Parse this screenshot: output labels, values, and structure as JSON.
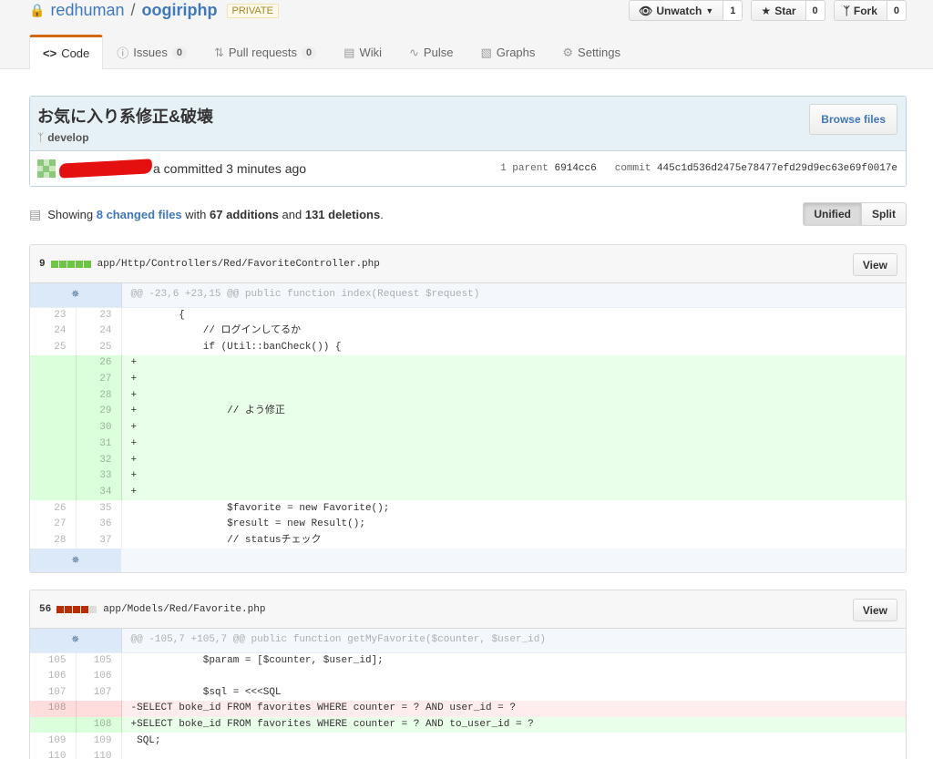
{
  "repo": {
    "owner": "redhuman",
    "name": "oogiriphp",
    "visibility": "PRIVATE"
  },
  "actions": [
    {
      "label": "Unwatch",
      "count": "1"
    },
    {
      "label": "Star",
      "count": "0"
    },
    {
      "label": "Fork",
      "count": "0"
    }
  ],
  "nav": [
    {
      "label": "Code",
      "icon": "code-icon",
      "counter": ""
    },
    {
      "label": "Issues",
      "icon": "issue-icon",
      "counter": "0"
    },
    {
      "label": "Pull requests",
      "icon": "pull-request-icon",
      "counter": "0"
    },
    {
      "label": "Wiki",
      "icon": "book-icon",
      "counter": ""
    },
    {
      "label": "Pulse",
      "icon": "pulse-icon",
      "counter": ""
    },
    {
      "label": "Graphs",
      "icon": "graph-icon",
      "counter": ""
    },
    {
      "label": "Settings",
      "icon": "gear-icon",
      "counter": ""
    }
  ],
  "commit": {
    "title": "お気に入り系修正&破壊",
    "branch": "develop",
    "browse_label": "Browse files",
    "author_tail": "a committed 3 minutes ago",
    "parent_label": "1 parent",
    "parent_sha": "6914cc6",
    "commit_label": "commit",
    "commit_sha": "445c1d536d2475e78477efd29d9ec63e69f0017e"
  },
  "toc": {
    "showing": "Showing",
    "changed": "8 changed files",
    "with": "with",
    "additions": "67 additions",
    "and": "and",
    "deletions": "131 deletions",
    "unified": "Unified",
    "split": "Split"
  },
  "files": [
    {
      "count": "9",
      "path": "app/Http/Controllers/Red/FavoriteController.php",
      "view_label": "View",
      "hunk": "@@ -23,6 +23,15 @@ public function index(Request $request)",
      "lines": [
        {
          "type": "ctx",
          "old": "23",
          "new": "23",
          "code": "        {"
        },
        {
          "type": "ctx",
          "old": "24",
          "new": "24",
          "code": "            // ログインしてるか"
        },
        {
          "type": "ctx",
          "old": "25",
          "new": "25",
          "code": "            if (Util::banCheck()) {"
        },
        {
          "type": "add",
          "old": "",
          "new": "26",
          "code": "+"
        },
        {
          "type": "add",
          "old": "",
          "new": "27",
          "code": "+"
        },
        {
          "type": "add",
          "old": "",
          "new": "28",
          "code": "+"
        },
        {
          "type": "add",
          "old": "",
          "new": "29",
          "code": "+               // よう修正"
        },
        {
          "type": "add",
          "old": "",
          "new": "30",
          "code": "+"
        },
        {
          "type": "add",
          "old": "",
          "new": "31",
          "code": "+"
        },
        {
          "type": "add",
          "old": "",
          "new": "32",
          "code": "+"
        },
        {
          "type": "add",
          "old": "",
          "new": "33",
          "code": "+"
        },
        {
          "type": "add",
          "old": "",
          "new": "34",
          "code": "+"
        },
        {
          "type": "ctx",
          "old": "26",
          "new": "35",
          "code": "                $favorite = new Favorite();"
        },
        {
          "type": "ctx",
          "old": "27",
          "new": "36",
          "code": "                $result = new Result();"
        },
        {
          "type": "ctx",
          "old": "28",
          "new": "37",
          "code": "                // statusチェック"
        }
      ]
    },
    {
      "count": "56",
      "path": "app/Models/Red/Favorite.php",
      "view_label": "View",
      "hunk": "@@ -105,7 +105,7 @@ public function getMyFavorite($counter, $user_id)",
      "lines": [
        {
          "type": "ctx",
          "old": "105",
          "new": "105",
          "code": "            $param = [$counter, $user_id];"
        },
        {
          "type": "ctx",
          "old": "106",
          "new": "106",
          "code": ""
        },
        {
          "type": "ctx",
          "old": "107",
          "new": "107",
          "code": "            $sql = <<<SQL"
        },
        {
          "type": "del",
          "old": "108",
          "new": "",
          "code": "-SELECT boke_id FROM favorites WHERE counter = ? AND user_id = ?"
        },
        {
          "type": "add",
          "old": "",
          "new": "108",
          "code": "+SELECT boke_id FROM favorites WHERE counter = ? AND to_user_id = ?"
        },
        {
          "type": "ctx",
          "old": "109",
          "new": "109",
          "code": " SQL;"
        },
        {
          "type": "ctx",
          "old": "110",
          "new": "110",
          "code": ""
        }
      ]
    }
  ],
  "colors": {
    "link": "#4078c0",
    "add_bg": "#eaffea",
    "del_bg": "#ffecec",
    "accent": "#d26911"
  }
}
